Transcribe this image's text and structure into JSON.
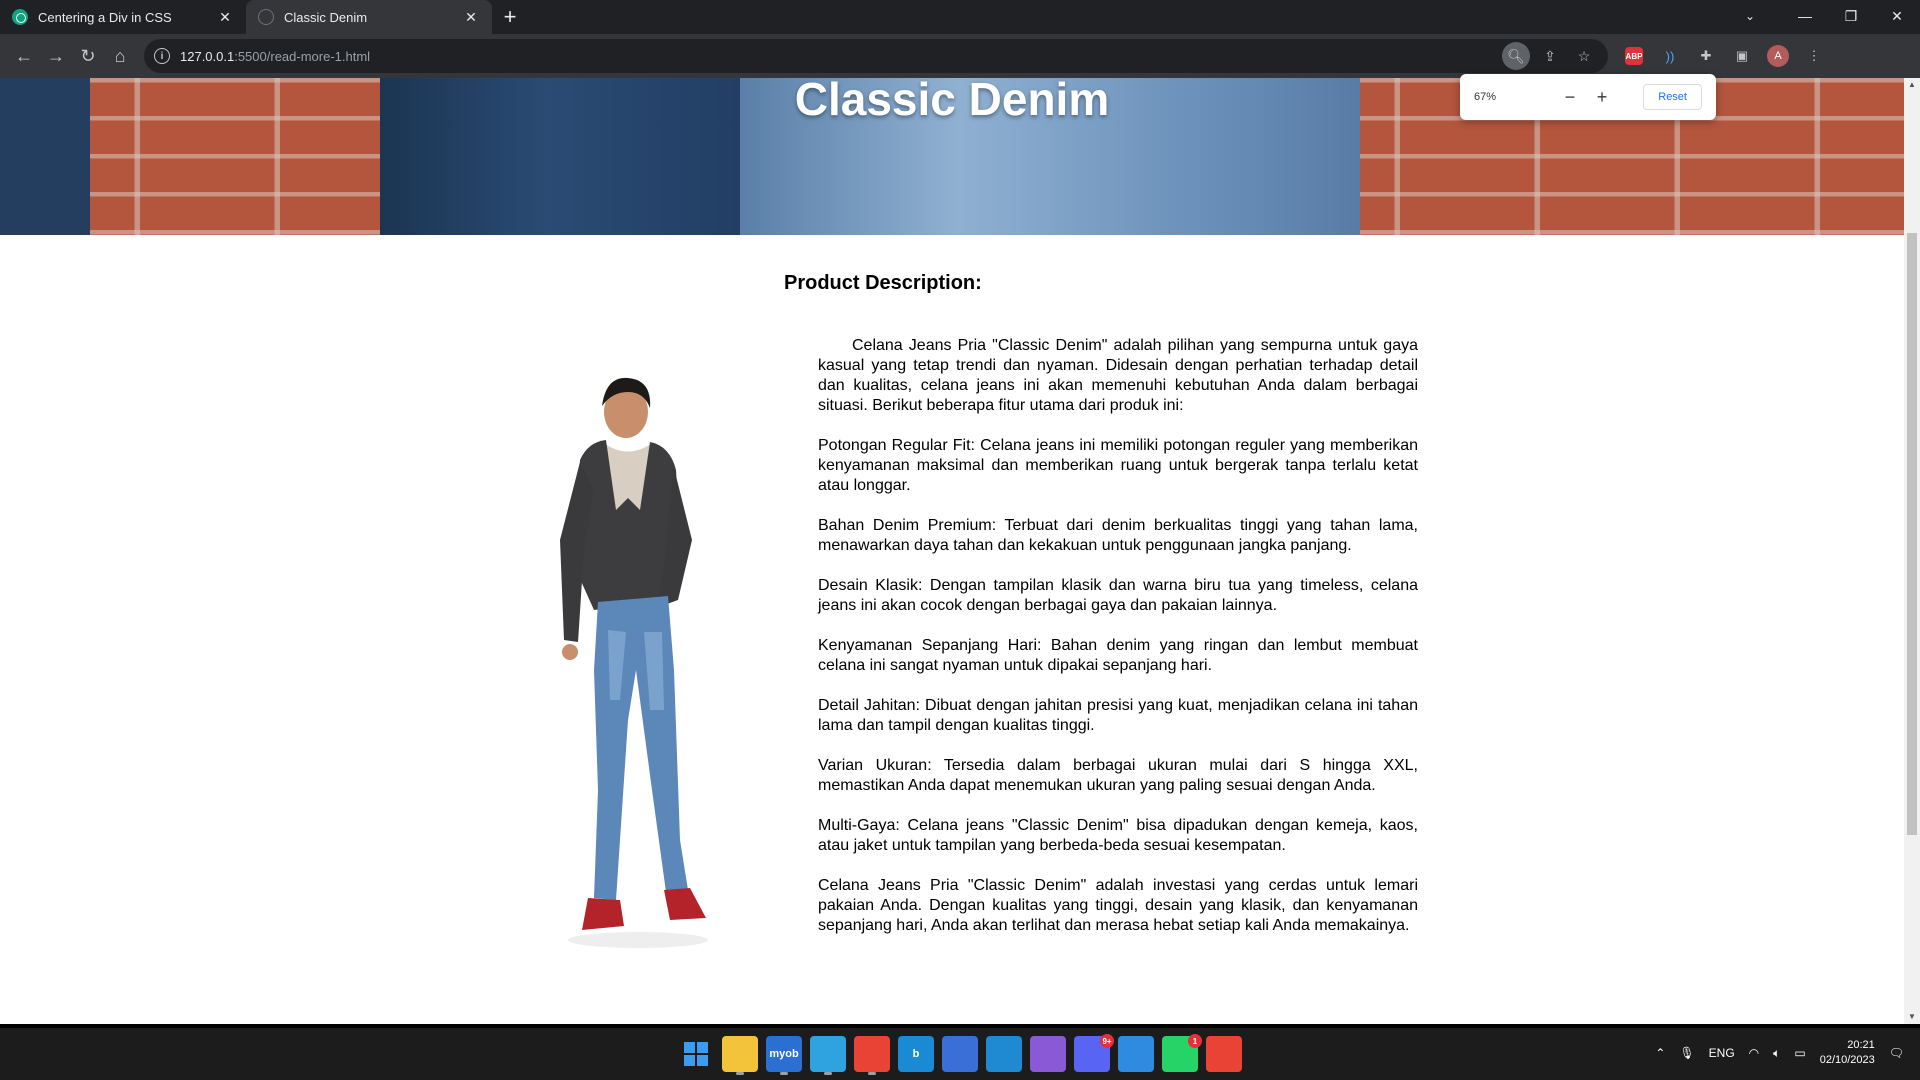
{
  "browser": {
    "tabs": [
      {
        "title": "Centering a Div in CSS",
        "favicon": "chatgpt-icon",
        "active": false
      },
      {
        "title": "Classic Denim",
        "favicon": "globe-icon",
        "active": true
      }
    ],
    "new_tab_label": "+",
    "url_host": "127.0.0.1",
    "url_path": ":5500/read-more-1.html",
    "avatar_letter": "A",
    "abp_label": "ABP"
  },
  "zoom_popup": {
    "level": "67%",
    "minus": "−",
    "plus": "+",
    "reset_label": "Reset"
  },
  "page": {
    "hero_title": "Classic Denim",
    "description_heading": "Product Description:",
    "paragraphs": [
      "Celana Jeans Pria \"Classic Denim\" adalah pilihan yang sempurna untuk gaya kasual yang tetap trendi dan nyaman. Didesain dengan perhatian terhadap detail dan kualitas, celana jeans ini akan memenuhi kebutuhan Anda dalam berbagai situasi. Berikut beberapa fitur utama dari produk ini:",
      "Potongan Regular Fit: Celana jeans ini memiliki potongan reguler yang memberikan kenyamanan maksimal dan memberikan ruang untuk bergerak tanpa terlalu ketat atau longgar.",
      "Bahan Denim Premium: Terbuat dari denim berkualitas tinggi yang tahan lama, menawarkan daya tahan dan kekakuan untuk penggunaan jangka panjang.",
      "Desain Klasik: Dengan tampilan klasik dan warna biru tua yang timeless, celana jeans ini akan cocok dengan berbagai gaya dan pakaian lainnya.",
      "Kenyamanan Sepanjang Hari: Bahan denim yang ringan dan lembut membuat celana ini sangat nyaman untuk dipakai sepanjang hari.",
      "Detail Jahitan: Dibuat dengan jahitan presisi yang kuat, menjadikan celana ini tahan lama dan tampil dengan kualitas tinggi.",
      "Varian Ukuran: Tersedia dalam berbagai ukuran mulai dari S hingga XXL, memastikan Anda dapat menemukan ukuran yang paling sesuai dengan Anda.",
      "Multi-Gaya: Celana jeans \"Classic Denim\" bisa dipadukan dengan kemeja, kaos, atau jaket untuk tampilan yang berbeda-beda sesuai kesempatan.",
      "Celana Jeans Pria \"Classic Denim\" adalah investasi yang cerdas untuk lemari pakaian Anda. Dengan kualitas yang tinggi, desain yang klasik, dan kenyamanan sepanjang hari, Anda akan terlihat dan merasa hebat setiap kali Anda memakainya."
    ]
  },
  "taskbar": {
    "apps": [
      {
        "name": "windows-start",
        "color": "#3b9cf0"
      },
      {
        "name": "file-explorer",
        "color": "#f3c33a"
      },
      {
        "name": "myob",
        "color": "#2a6fd1",
        "label": "myob"
      },
      {
        "name": "edge-beta",
        "color": "#2fa3e0"
      },
      {
        "name": "chrome",
        "color": "#e94335",
        "badge": ""
      },
      {
        "name": "bing",
        "color": "#1a8ad4",
        "label": "b"
      },
      {
        "name": "power-automate",
        "color": "#3a6fd8"
      },
      {
        "name": "vscode",
        "color": "#1f8ad2"
      },
      {
        "name": "github-desktop",
        "color": "#8a59d6"
      },
      {
        "name": "discord",
        "color": "#5865f2",
        "badge": "9+"
      },
      {
        "name": "snipping-tool",
        "color": "#2e8be0"
      },
      {
        "name": "whatsapp",
        "color": "#25d366",
        "badge": "1"
      },
      {
        "name": "chrome-profile",
        "color": "#e94335"
      }
    ],
    "language": "ENG",
    "time": "20:21",
    "date": "02/10/2023"
  }
}
